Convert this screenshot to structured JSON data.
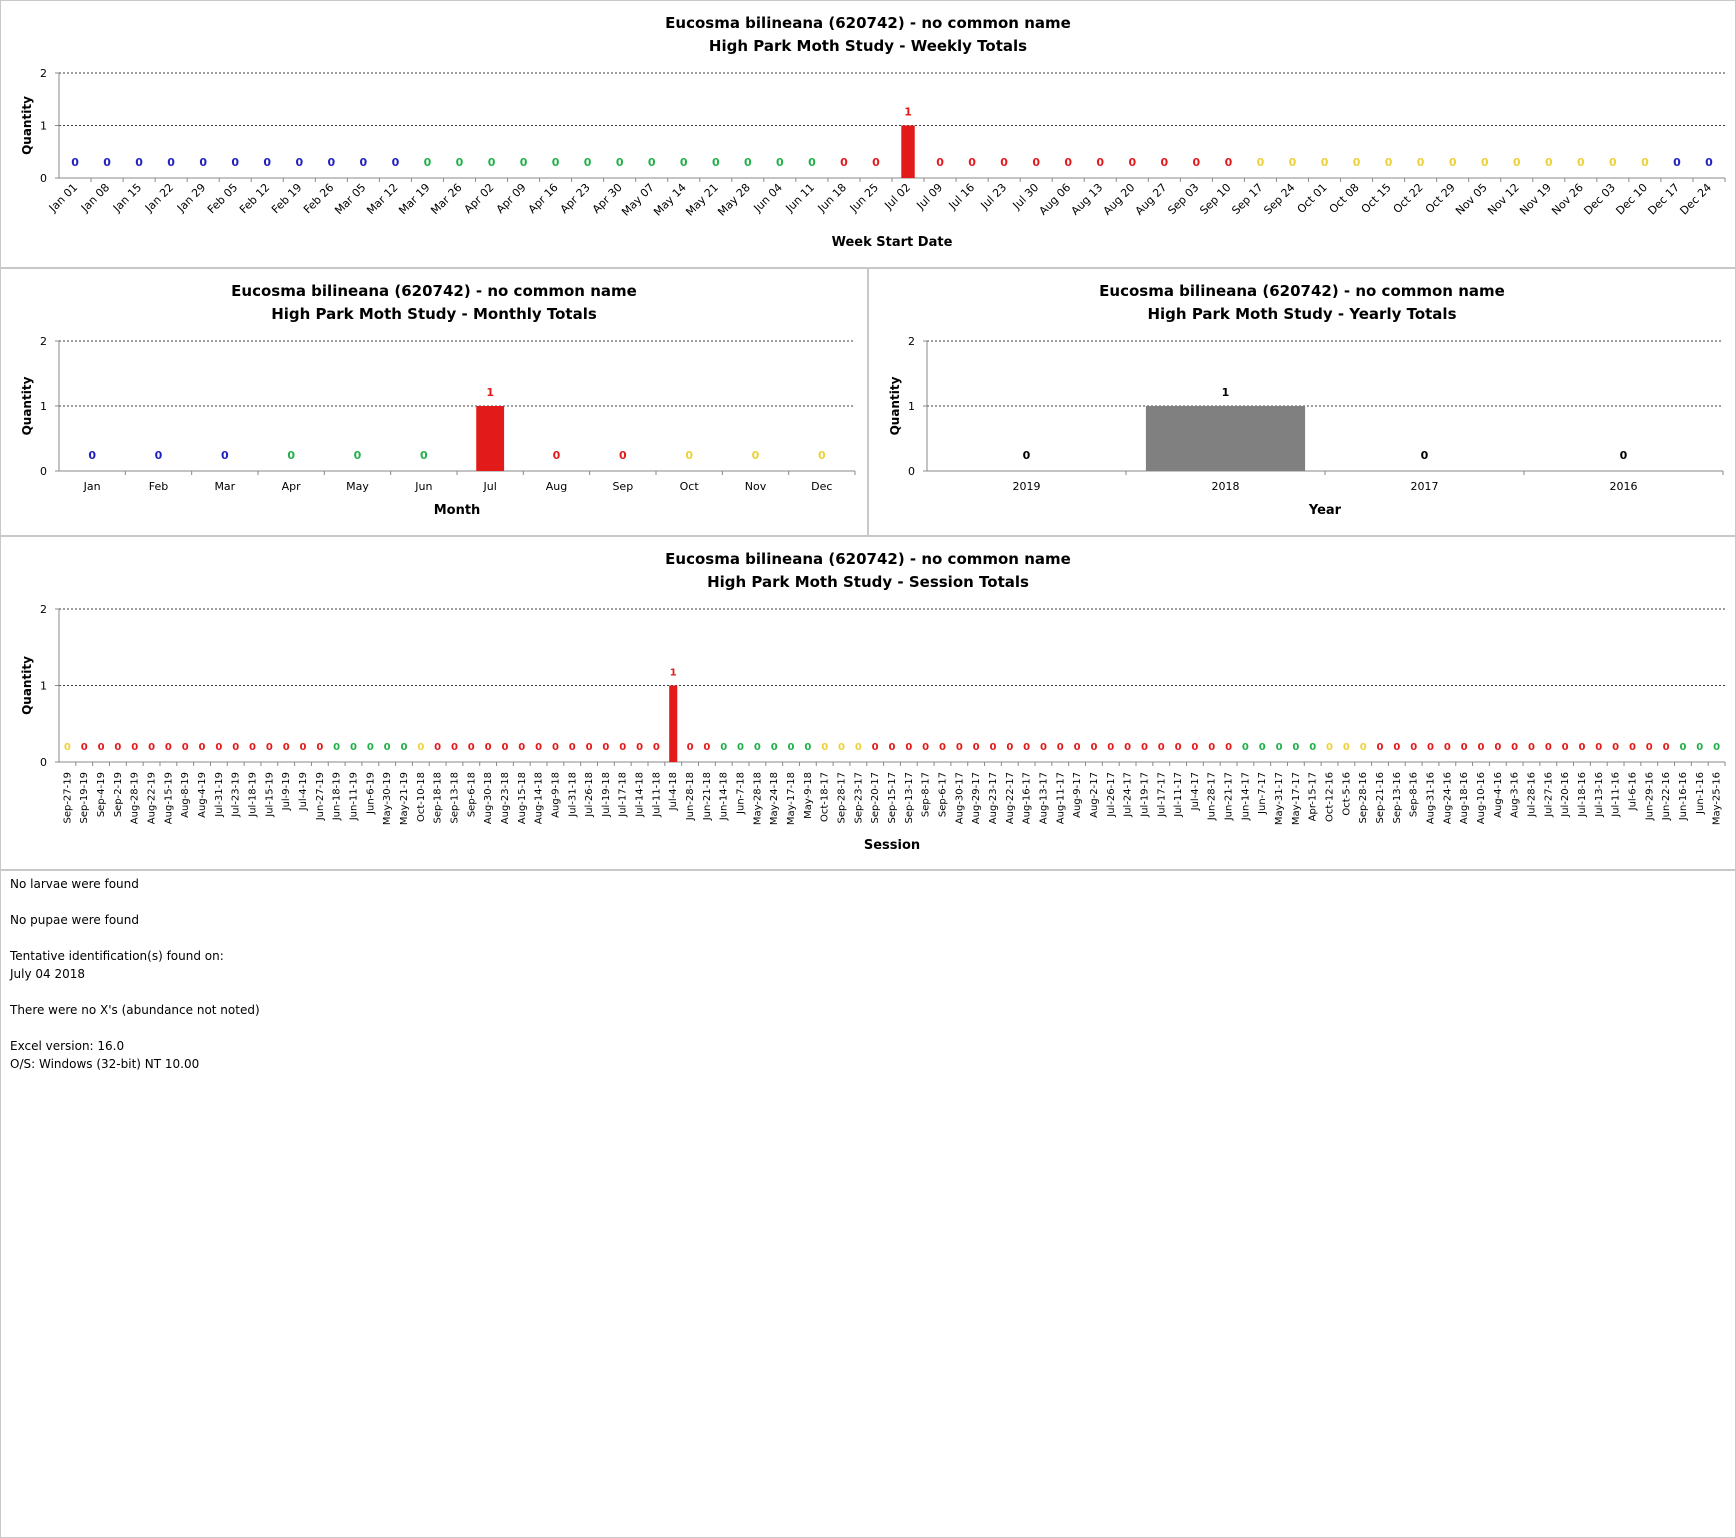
{
  "common": {
    "title_line1": "Eucosma bilineana (620742)  - no common name",
    "ylabel": "Quantity",
    "colors": {
      "blue": "#2020c0",
      "green": "#22b04a",
      "red": "#e31a1a",
      "yellow": "#ecd23a",
      "gray": "#808080"
    }
  },
  "chart_data": [
    {
      "id": "weekly",
      "type": "bar",
      "title": "High Park Moth Study  -  Weekly Totals",
      "xlabel": "Week Start Date",
      "ylabel": "Quantity",
      "ylim": [
        0,
        2
      ],
      "yticks": [
        0,
        1,
        2
      ],
      "categories": [
        "Jan 01",
        "Jan 08",
        "Jan 15",
        "Jan 22",
        "Jan 29",
        "Feb 05",
        "Feb 12",
        "Feb 19",
        "Feb 26",
        "Mar 05",
        "Mar 12",
        "Mar 19",
        "Mar 26",
        "Apr 02",
        "Apr 09",
        "Apr 16",
        "Apr 23",
        "Apr 30",
        "May 07",
        "May 14",
        "May 21",
        "May 28",
        "Jun 04",
        "Jun 11",
        "Jun 18",
        "Jun 25",
        "Jul 02",
        "Jul 09",
        "Jul 16",
        "Jul 23",
        "Jul 30",
        "Aug 06",
        "Aug 13",
        "Aug 20",
        "Aug 27",
        "Sep 03",
        "Sep 10",
        "Sep 17",
        "Sep 24",
        "Oct 01",
        "Oct 08",
        "Oct 15",
        "Oct 22",
        "Oct 29",
        "Nov 05",
        "Nov 12",
        "Nov 19",
        "Nov 26",
        "Dec 03",
        "Dec 10",
        "Dec 17",
        "Dec 24"
      ],
      "values": [
        0,
        0,
        0,
        0,
        0,
        0,
        0,
        0,
        0,
        0,
        0,
        0,
        0,
        0,
        0,
        0,
        0,
        0,
        0,
        0,
        0,
        0,
        0,
        0,
        0,
        0,
        1,
        0,
        0,
        0,
        0,
        0,
        0,
        0,
        0,
        0,
        0,
        0,
        0,
        0,
        0,
        0,
        0,
        0,
        0,
        0,
        0,
        0,
        0,
        0,
        0,
        0
      ],
      "colors": [
        "blue",
        "blue",
        "blue",
        "blue",
        "blue",
        "blue",
        "blue",
        "blue",
        "blue",
        "blue",
        "blue",
        "green",
        "green",
        "green",
        "green",
        "green",
        "green",
        "green",
        "green",
        "green",
        "green",
        "green",
        "green",
        "green",
        "red",
        "red",
        "red",
        "red",
        "red",
        "red",
        "red",
        "red",
        "red",
        "red",
        "red",
        "red",
        "red",
        "yellow",
        "yellow",
        "yellow",
        "yellow",
        "yellow",
        "yellow",
        "yellow",
        "yellow",
        "yellow",
        "yellow",
        "yellow",
        "yellow",
        "yellow",
        "blue",
        "blue"
      ],
      "grid": true
    },
    {
      "id": "monthly",
      "type": "bar",
      "title": "High Park Moth Study  -  Monthly Totals",
      "xlabel": "Month",
      "ylabel": "Quantity",
      "ylim": [
        0,
        2
      ],
      "yticks": [
        0,
        1,
        2
      ],
      "categories": [
        "Jan",
        "Feb",
        "Mar",
        "Apr",
        "May",
        "Jun",
        "Jul",
        "Aug",
        "Sep",
        "Oct",
        "Nov",
        "Dec"
      ],
      "values": [
        0,
        0,
        0,
        0,
        0,
        0,
        1,
        0,
        0,
        0,
        0,
        0
      ],
      "colors": [
        "blue",
        "blue",
        "blue",
        "green",
        "green",
        "green",
        "red",
        "red",
        "red",
        "yellow",
        "yellow",
        "yellow"
      ],
      "grid": true
    },
    {
      "id": "yearly",
      "type": "bar",
      "title": "High Park Moth Study  -  Yearly Totals",
      "xlabel": "Year",
      "ylabel": "Quantity",
      "ylim": [
        0,
        2
      ],
      "yticks": [
        0,
        1,
        2
      ],
      "categories": [
        "2019",
        "2018",
        "2017",
        "2016"
      ],
      "values": [
        0,
        1,
        0,
        0
      ],
      "colors": [
        "gray",
        "gray",
        "gray",
        "gray"
      ],
      "label_color": "#000000",
      "grid": true
    },
    {
      "id": "session",
      "type": "bar",
      "title": "High Park Moth Study  -  Session Totals",
      "xlabel": "Session",
      "ylabel": "Quantity",
      "ylim": [
        0,
        2
      ],
      "yticks": [
        0,
        1,
        2
      ],
      "categories": [
        "Sep-27-19",
        "Sep-19-19",
        "Sep-4-19",
        "Sep-2-19",
        "Aug-28-19",
        "Aug-22-19",
        "Aug-15-19",
        "Aug-8-19",
        "Aug-4-19",
        "Jul-31-19",
        "Jul-23-19",
        "Jul-18-19",
        "Jul-15-19",
        "Jul-9-19",
        "Jul-4-19",
        "Jun-27-19",
        "Jun-18-19",
        "Jun-11-19",
        "Jun-6-19",
        "May-30-19",
        "May-21-19",
        "Oct-10-18",
        "Sep-18-18",
        "Sep-13-18",
        "Sep-6-18",
        "Aug-30-18",
        "Aug-23-18",
        "Aug-15-18",
        "Aug-14-18",
        "Aug-9-18",
        "Jul-31-18",
        "Jul-26-18",
        "Jul-19-18",
        "Jul-17-18",
        "Jul-14-18",
        "Jul-11-18",
        "Jul-4-18",
        "Jun-28-18",
        "Jun-21-18",
        "Jun-14-18",
        "Jun-7-18",
        "May-28-18",
        "May-24-18",
        "May-17-18",
        "May-9-18",
        "Oct-18-17",
        "Sep-28-17",
        "Sep-23-17",
        "Sep-20-17",
        "Sep-15-17",
        "Sep-13-17",
        "Sep-8-17",
        "Sep-6-17",
        "Aug-30-17",
        "Aug-29-17",
        "Aug-23-17",
        "Aug-22-17",
        "Aug-16-17",
        "Aug-13-17",
        "Aug-11-17",
        "Aug-9-17",
        "Aug-2-17",
        "Jul-26-17",
        "Jul-24-17",
        "Jul-19-17",
        "Jul-17-17",
        "Jul-11-17",
        "Jul-4-17",
        "Jun-28-17",
        "Jun-21-17",
        "Jun-14-17",
        "Jun-7-17",
        "May-31-17",
        "May-17-17",
        "Apr-15-17",
        "Oct-12-16",
        "Oct-5-16",
        "Sep-28-16",
        "Sep-21-16",
        "Sep-13-16",
        "Sep-8-16",
        "Aug-31-16",
        "Aug-24-16",
        "Aug-18-16",
        "Aug-10-16",
        "Aug-4-16",
        "Aug-3-16",
        "Jul-28-16",
        "Jul-27-16",
        "Jul-20-16",
        "Jul-18-16",
        "Jul-13-16",
        "Jul-11-16",
        "Jul-6-16",
        "Jun-29-16",
        "Jun-22-16",
        "Jun-16-16",
        "Jun-1-16",
        "May-25-16"
      ],
      "values": [
        0,
        0,
        0,
        0,
        0,
        0,
        0,
        0,
        0,
        0,
        0,
        0,
        0,
        0,
        0,
        0,
        0,
        0,
        0,
        0,
        0,
        0,
        0,
        0,
        0,
        0,
        0,
        0,
        0,
        0,
        0,
        0,
        0,
        0,
        0,
        0,
        1,
        0,
        0,
        0,
        0,
        0,
        0,
        0,
        0,
        0,
        0,
        0,
        0,
        0,
        0,
        0,
        0,
        0,
        0,
        0,
        0,
        0,
        0,
        0,
        0,
        0,
        0,
        0,
        0,
        0,
        0,
        0,
        0,
        0,
        0,
        0,
        0,
        0,
        0,
        0,
        0,
        0,
        0,
        0,
        0,
        0,
        0,
        0,
        0,
        0,
        0,
        0,
        0,
        0,
        0,
        0,
        0,
        0,
        0,
        0,
        0,
        0,
        0
      ],
      "colors": [
        "yellow",
        "red",
        "red",
        "red",
        "red",
        "red",
        "red",
        "red",
        "red",
        "red",
        "red",
        "red",
        "red",
        "red",
        "red",
        "red",
        "green",
        "green",
        "green",
        "green",
        "green",
        "yellow",
        "red",
        "red",
        "red",
        "red",
        "red",
        "red",
        "red",
        "red",
        "red",
        "red",
        "red",
        "red",
        "red",
        "red",
        "red",
        "red",
        "red",
        "green",
        "green",
        "green",
        "green",
        "green",
        "green",
        "yellow",
        "yellow",
        "yellow",
        "red",
        "red",
        "red",
        "red",
        "red",
        "red",
        "red",
        "red",
        "red",
        "red",
        "red",
        "red",
        "red",
        "red",
        "red",
        "red",
        "red",
        "red",
        "red",
        "red",
        "red",
        "red",
        "green",
        "green",
        "green",
        "green",
        "green",
        "yellow",
        "yellow",
        "yellow",
        "red",
        "red",
        "red",
        "red",
        "red",
        "red",
        "red",
        "red",
        "red",
        "red",
        "red",
        "red",
        "red",
        "red",
        "red",
        "red",
        "red",
        "red",
        "green",
        "green",
        "green",
        "green"
      ],
      "grid": true
    }
  ],
  "notes": {
    "larvae": "No larvae were found",
    "pupae": "No pupae were found",
    "tentative_label": "Tentative identification(s) found on:",
    "tentative_date": "July 04 2018",
    "xs": "There were no X's (abundance not noted)",
    "excel": "Excel version: 16.0",
    "os": "O/S: Windows (32-bit) NT 10.00"
  }
}
